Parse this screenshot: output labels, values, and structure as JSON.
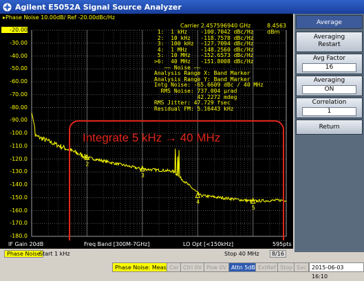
{
  "window": {
    "title": "Agilent E5052A Signal Source Analyzer"
  },
  "plot": {
    "header": "▸Phase Noise 10.00dB/ Ref -20.00dBc/Hz",
    "y_ticks": [
      "-20.00",
      "-30.00",
      "-40.00",
      "-50.00",
      "-60.00",
      "-70.00",
      "-80.00",
      "-90.00",
      "-100.0",
      "-110.0",
      "-120.0",
      "-130.0",
      "-140.0",
      "-150.0",
      "-160.0",
      "-170.0",
      "-180.0"
    ],
    "carrier": "Carrier 2.457596940 GHz",
    "carrier_amp": "8.4563 dBm",
    "readouts": [
      " 1:  1 kHz    -100.7042 dBc/Hz",
      " 2:  10 kHz   -118.7578 dBc/Hz",
      " 3:  100 kHz  -127.7094 dBc/Hz",
      " 4:  1 MHz    -148.2560 dBc/Hz",
      " 5:  10 MHz   -152.6573 dBc/Hz",
      ">6:  40 MHz   -151.8008 dBc/Hz",
      "   —— Noise ——",
      "Analysis Range X: Band Marker",
      "Analysis Range Y: Band Marker",
      "Intg Noise: -65.6609 dBc / 40 MHz",
      "  RMS Noise: 737.004 µrad",
      "             42.2272 mdeg",
      "RMS Jitter: 47.729 fsec",
      "Residual FM: 5.16443 kHz"
    ],
    "annotation": "Integrate 5 kHz → 40 MHz",
    "markers": [
      "2",
      "3",
      "4",
      "5"
    ],
    "trace_color": "#ffff00"
  },
  "statusbar": {
    "if_gain": "IF Gain 20dB",
    "freq_band": "Freq Band [300M-7GHz]",
    "lo_opt": "LO Opt [<150kHz]",
    "points": "595pts"
  },
  "softmenu": {
    "title": "Average",
    "items": [
      {
        "label": "Averaging",
        "value": "Restart",
        "plain": true
      },
      {
        "label": "Avg Factor",
        "value": "16"
      },
      {
        "label": "Averaging",
        "value": "ON"
      },
      {
        "label": "Correlation",
        "value": "1"
      },
      {
        "label": "Return",
        "value": ""
      }
    ]
  },
  "sweep": {
    "active": "Phase Noise",
    "start": "Start 1 kHz",
    "stop": "Stop 40 MHz",
    "counter": "8/16"
  },
  "indicators": {
    "meas": "Phase Noise: Meas",
    "cor": "Cor",
    "ctrl": "Ctrl 0V",
    "pow": "Pow 0V",
    "attn": "Attn 5dB",
    "extref": "ExtRef",
    "stop": "Stop",
    "svc": "Svc",
    "datetime": "2015-06-03 16:10"
  },
  "colors": {
    "trace": "#ffff00",
    "annotation": "#e0261b",
    "background": "#000000",
    "grid": "#808080"
  }
}
